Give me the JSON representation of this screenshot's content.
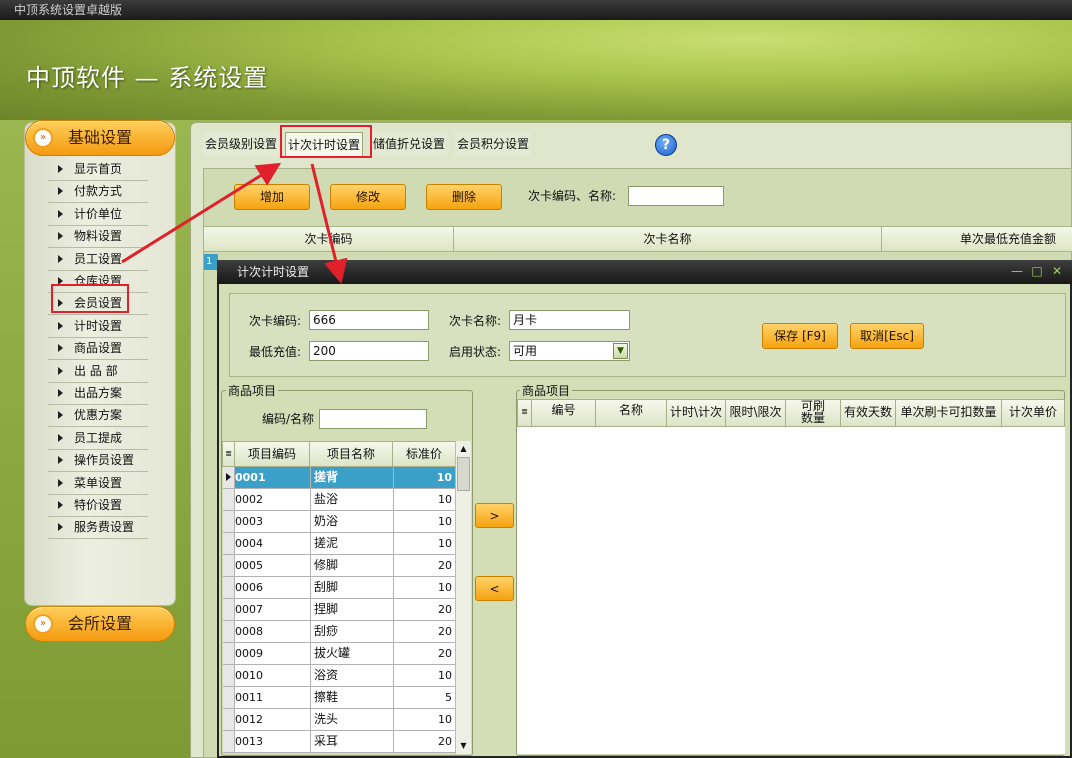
{
  "window": {
    "title": "中顶系统设置卓越版"
  },
  "brand": {
    "title": "中顶软件 — 系统设置"
  },
  "sidebar": {
    "basic_header": "基础设置",
    "club_header": "会所设置",
    "items": [
      "显示首页",
      "付款方式",
      "计价单位",
      "物料设置",
      "员工设置",
      "仓库设置",
      "会员设置",
      "计时设置",
      "商品设置",
      "出 品 部",
      "出品方案",
      "优惠方案",
      "员工提成",
      "操作员设置",
      "菜单设置",
      "特价设置",
      "服务费设置"
    ]
  },
  "tabs": [
    "会员级别设置",
    "计次计时设置",
    "储值折兑设置",
    "会员积分设置"
  ],
  "toolbar": {
    "add": "增加",
    "edit": "修改",
    "delete": "删除",
    "search_label": "次卡编码、名称:",
    "search_value": ""
  },
  "bg_grid": {
    "headers": [
      "次卡编码",
      "次卡名称",
      "单次最低充值金额"
    ],
    "row_marker": "1"
  },
  "dialog": {
    "title": "计次计时设置",
    "card_code_label": "次卡编码:",
    "card_code": "666",
    "card_name_label": "次卡名称:",
    "card_name": "月卡",
    "min_recharge_label": "最低充值:",
    "min_recharge": "200",
    "status_label": "启用状态:",
    "status": "可用",
    "save": "保存 [F9]",
    "cancel": "取消[Esc]",
    "left_group": "商品项目",
    "right_group": "商品项目",
    "filter_label": "编码/名称",
    "filter_value": "",
    "left_headers": [
      "项目编码",
      "项目名称",
      "标准价"
    ],
    "right_headers": [
      "编号",
      "名称",
      "计时\\计次",
      "限时\\限次",
      "可刷数量",
      "有效天数",
      "单次刷卡可扣数量",
      "计次单价"
    ],
    "move_right": ">",
    "move_left": "<",
    "products": [
      {
        "code": "0001",
        "name": "搓背",
        "price": "10"
      },
      {
        "code": "0002",
        "name": "盐浴",
        "price": "10"
      },
      {
        "code": "0003",
        "name": "奶浴",
        "price": "10"
      },
      {
        "code": "0004",
        "name": "搓泥",
        "price": "10"
      },
      {
        "code": "0005",
        "name": "修脚",
        "price": "20"
      },
      {
        "code": "0006",
        "name": "刮脚",
        "price": "10"
      },
      {
        "code": "0007",
        "name": "捏脚",
        "price": "20"
      },
      {
        "code": "0008",
        "name": "刮痧",
        "price": "20"
      },
      {
        "code": "0009",
        "name": "拔火罐",
        "price": "20"
      },
      {
        "code": "0010",
        "name": "浴资",
        "price": "10"
      },
      {
        "code": "0011",
        "name": "擦鞋",
        "price": "5"
      },
      {
        "code": "0012",
        "name": "洗头",
        "price": "10"
      },
      {
        "code": "0013",
        "name": "采耳",
        "price": "20"
      }
    ]
  },
  "colors": {
    "accent_orange": "#f5a20f",
    "highlight_red": "#e0202a",
    "selected_row": "#3aa0c8"
  }
}
